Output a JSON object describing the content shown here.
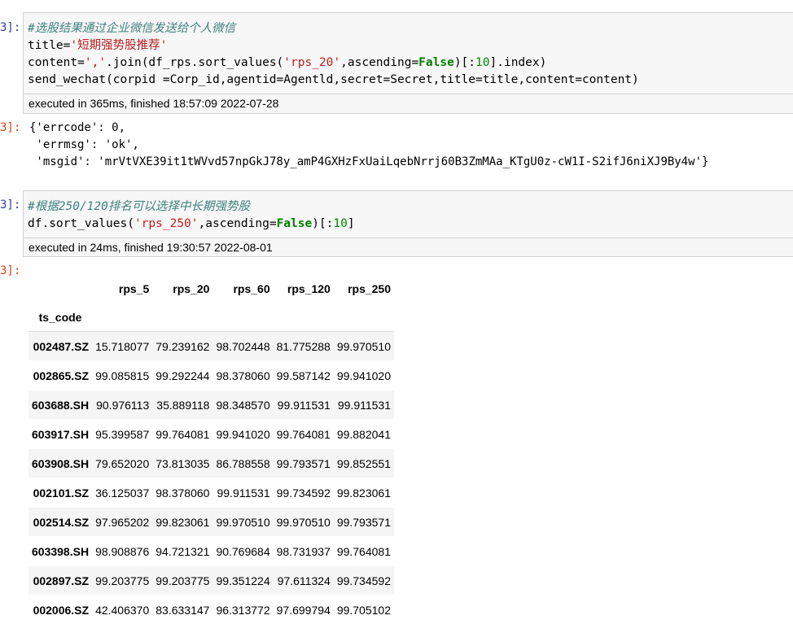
{
  "cells": {
    "cell1": {
      "prompt_in": "3]:",
      "comment": "#选股结果通过企业微信发送给个人微信",
      "line2_a": "title=",
      "line2_str": "'短期强势股推荐'",
      "line3_a": "content=",
      "line3_str1": "','",
      "line3_b": ".join(df_rps.sort_values(",
      "line3_str2": "'rps_20'",
      "line3_c": ",ascending=",
      "line3_kw": "False",
      "line3_d": ")[:",
      "line3_num": "10",
      "line3_e": "].index)",
      "line4": "send_wechat(corpid =Corp_id,agentid=Agentld,secret=Secret,title=title,content=content)",
      "exec_info": "executed in 365ms, finished 18:57:09 2022-07-28"
    },
    "out1": {
      "prompt_out": "3]:",
      "line1": "{'errcode': 0,",
      "line2": " 'errmsg': 'ok',",
      "line3": " 'msgid': 'mrVtVXE39it1tWVvd57npGkJ78y_amP4GXHzFxUaiLqebNrrj60B3ZmMAa_KTgU0z-cW1I-S2ifJ6niXJ9By4w'}"
    },
    "cell2": {
      "prompt_in": "3]:",
      "comment": "#根据250/120排名可以选择中长期强势股",
      "line2_a": "df.sort_values(",
      "line2_str": "'rps_250'",
      "line2_b": ",ascending=",
      "line2_kw": "False",
      "line2_c": ")[:",
      "line2_num": "10",
      "line2_d": "]",
      "exec_info": "executed in 24ms, finished 19:30:57 2022-08-01"
    },
    "out2": {
      "prompt_out": "3]:"
    }
  },
  "table": {
    "columns": [
      "rps_5",
      "rps_20",
      "rps_60",
      "rps_120",
      "rps_250"
    ],
    "index_name": "ts_code",
    "rows": [
      {
        "code": "002487.SZ",
        "values": [
          "15.718077",
          "79.239162",
          "98.702448",
          "81.775288",
          "99.970510"
        ]
      },
      {
        "code": "002865.SZ",
        "values": [
          "99.085815",
          "99.292244",
          "98.378060",
          "99.587142",
          "99.941020"
        ]
      },
      {
        "code": "603688.SH",
        "values": [
          "90.976113",
          "35.889118",
          "98.348570",
          "99.911531",
          "99.911531"
        ]
      },
      {
        "code": "603917.SH",
        "values": [
          "95.399587",
          "99.764081",
          "99.941020",
          "99.764081",
          "99.882041"
        ]
      },
      {
        "code": "603908.SH",
        "values": [
          "79.652020",
          "73.813035",
          "86.788558",
          "99.793571",
          "99.852551"
        ]
      },
      {
        "code": "002101.SZ",
        "values": [
          "36.125037",
          "98.378060",
          "99.911531",
          "99.734592",
          "99.823061"
        ]
      },
      {
        "code": "002514.SZ",
        "values": [
          "97.965202",
          "99.823061",
          "99.970510",
          "99.970510",
          "99.793571"
        ]
      },
      {
        "code": "603398.SH",
        "values": [
          "98.908876",
          "94.721321",
          "90.769684",
          "98.731937",
          "99.764081"
        ]
      },
      {
        "code": "002897.SZ",
        "values": [
          "99.203775",
          "99.203775",
          "99.351224",
          "97.611324",
          "99.734592"
        ]
      },
      {
        "code": "002006.SZ",
        "values": [
          "42.406370",
          "83.633147",
          "96.313772",
          "97.699794",
          "99.705102"
        ]
      }
    ]
  }
}
